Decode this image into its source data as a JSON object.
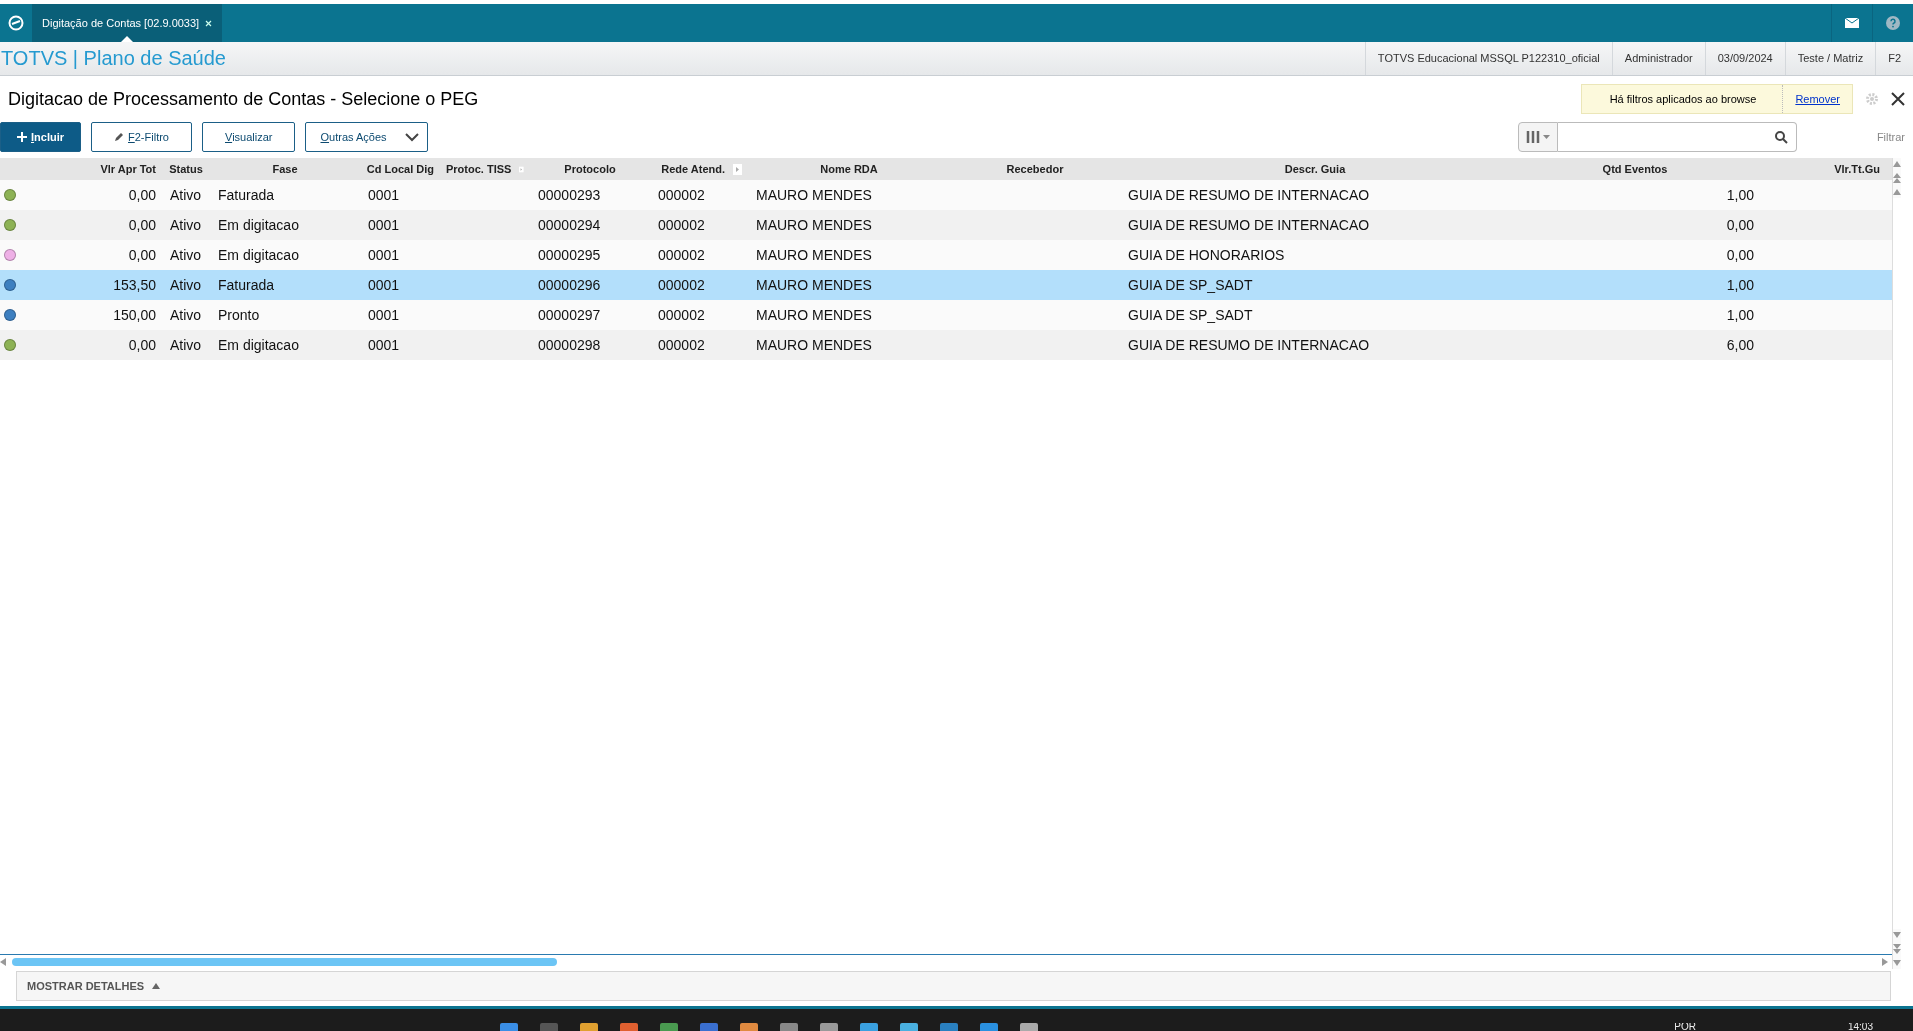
{
  "app_bar": {
    "tabs": [
      {
        "label": "Digitação de Contas [02.9.0033]",
        "selected": true
      }
    ]
  },
  "header": {
    "brand": "TOTVS | Plano de Saúde",
    "info": [
      "TOTVS Educacional MSSQL P122310_oficial",
      "Administrador",
      "03/09/2024",
      "Teste / Matriz",
      "F2"
    ]
  },
  "page": {
    "title": "Digitacao de Processamento de Contas - Selecione o PEG",
    "filter_notice": {
      "text": "Há filtros aplicados ao browse",
      "link": "Remover"
    }
  },
  "toolbar": {
    "buttons": [
      {
        "label": "Incluir",
        "kind": "primary"
      },
      {
        "label": "F2-Filtro",
        "kind": "filter"
      },
      {
        "label": "Visualizar",
        "kind": "plain"
      },
      {
        "label": "Outras Ações",
        "kind": "menu"
      }
    ],
    "filter_label": "Filtrar"
  },
  "table": {
    "columns": [
      "Vlr Apr Tot",
      "Status",
      "Fase",
      "Cd Local Dig",
      "Protoc. TISS",
      "Protocolo",
      "Rede Atend.",
      "Nome RDA",
      "Recebedor",
      "Descr. Guia",
      "Qtd Eventos",
      "Vlr.Tt.Gu"
    ],
    "rows": [
      {
        "color": "#8db255",
        "selected": false,
        "vlr_apr_tot": "0,00",
        "status": "Ativo",
        "fase": "Faturada",
        "cd_local_dig": "0001",
        "protocolo": "00000293",
        "rede_atend": "000002",
        "nome_rda": "MAURO MENDES",
        "descr_guia": "GUIA DE RESUMO DE INTERNACAO",
        "qtd_eventos": "1,00"
      },
      {
        "color": "#8db255",
        "selected": false,
        "vlr_apr_tot": "0,00",
        "status": "Ativo",
        "fase": "Em digitacao",
        "cd_local_dig": "0001",
        "protocolo": "00000294",
        "rede_atend": "000002",
        "nome_rda": "MAURO MENDES",
        "descr_guia": "GUIA DE RESUMO DE INTERNACAO",
        "qtd_eventos": "0,00"
      },
      {
        "color": "#eeb0e6",
        "selected": false,
        "vlr_apr_tot": "0,00",
        "status": "Ativo",
        "fase": "Em digitacao",
        "cd_local_dig": "0001",
        "protocolo": "00000295",
        "rede_atend": "000002",
        "nome_rda": "MAURO MENDES",
        "descr_guia": "GUIA DE HONORARIOS",
        "qtd_eventos": "0,00"
      },
      {
        "color": "#3d7fc0",
        "selected": true,
        "vlr_apr_tot": "153,50",
        "status": "Ativo",
        "fase": "Faturada",
        "cd_local_dig": "0001",
        "protocolo": "00000296",
        "rede_atend": "000002",
        "nome_rda": "MAURO MENDES",
        "descr_guia": "GUIA DE SP_SADT",
        "qtd_eventos": "1,00"
      },
      {
        "color": "#3d7fc0",
        "selected": false,
        "vlr_apr_tot": "150,00",
        "status": "Ativo",
        "fase": "Pronto",
        "cd_local_dig": "0001",
        "protocolo": "00000297",
        "rede_atend": "000002",
        "nome_rda": "MAURO MENDES",
        "descr_guia": "GUIA DE SP_SADT",
        "qtd_eventos": "1,00"
      },
      {
        "color": "#8db255",
        "selected": false,
        "vlr_apr_tot": "0,00",
        "status": "Ativo",
        "fase": "Em digitacao",
        "cd_local_dig": "0001",
        "protocolo": "00000298",
        "rede_atend": "000002",
        "nome_rda": "MAURO MENDES",
        "descr_guia": "GUIA DE RESUMO DE INTERNACAO",
        "qtd_eventos": "6,00"
      }
    ]
  },
  "details": {
    "label": "MOSTRAR DETALHES"
  },
  "taskbar": {
    "language": "POR",
    "time": "14:03"
  }
}
